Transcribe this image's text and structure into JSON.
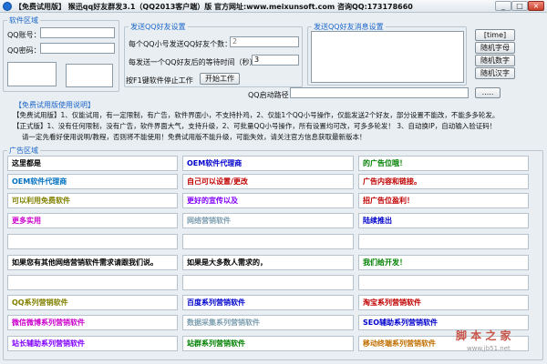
{
  "window": {
    "title": "【免费试用版】 猴迅qq好友群发3.1（QQ2013客户端）版  官方网址:www.meixunsoft.com 咨询QQ:173178660",
    "buttons": {
      "minimize": "_",
      "maximize": "□",
      "close": "×"
    }
  },
  "software_area": {
    "legend": "软件区域",
    "qq_label": "QQ账号：",
    "pwd_label": "QQ密码："
  },
  "friend_settings": {
    "legend": "发送QQ好友设置",
    "per_qq_label": "每个QQ小号发送QQ好友个数：",
    "per_qq_value": "2",
    "wait_label": "每发送一个QQ好友后的等待时间（秒）：",
    "wait_value": "3",
    "hint": "按F1键软件停止工作",
    "start_button": "开始工作"
  },
  "message_settings": {
    "legend": "发送QQ好友消息设置"
  },
  "side_buttons": [
    "[time]",
    "随机字母",
    "随机数字",
    "随机汉字"
  ],
  "qq_path": {
    "label": "QQ启动路径：",
    "value": "",
    "browse": "....."
  },
  "help": {
    "legend": "【免费试用版使用说明】",
    "lines": [
      "【免费试用版】1、仅能试用，有一定限制，有广告，软件界面小，不支持扑鸡，2、仅能1个QQ小号操作，仅能发送2个好友，部分设置不能改，不能多多轮发。",
      "【正式版】1、没有任何限制，没有广告，软件界面大气，支持升级，2、可批量QQ小号操作，所有设置均可改，可多多轮发！ 3、自动换IP，自动输入验证码！",
      "请一定先看好使用说明/教程，否则将不能使用！免费试用版不能升级，可能失效，请关注官方信息获取最新版本！"
    ]
  },
  "ads": {
    "legend": "广告区域",
    "cells": [
      {
        "text": "这里都是",
        "color": "#000000"
      },
      {
        "text": "OEM软件代理商",
        "color": "#0000cc"
      },
      {
        "text": "的广告位哦！",
        "color": "#008000"
      },
      {
        "text": "OEM软件代理商",
        "color": "#0070c0"
      },
      {
        "text": "自己可以设置/更改",
        "color": "#c00000"
      },
      {
        "text": "广告内容和链接。",
        "color": "#c00000"
      },
      {
        "text": "可以利用免费软件",
        "color": "#808000"
      },
      {
        "text": "更好的宣传以及",
        "color": "#8000ff"
      },
      {
        "text": "招广告位盈利！",
        "color": "#c00000"
      },
      {
        "text": "更多实用",
        "color": "#cc00cc"
      },
      {
        "text": "网络营销软件",
        "color": "#7f9fb0"
      },
      {
        "text": "陆续推出",
        "color": "#0000cc"
      },
      {
        "text": "",
        "color": "#000000"
      },
      {
        "text": "",
        "color": "#000000"
      },
      {
        "text": "",
        "color": "#000000"
      },
      {
        "text": "如果您有其他网络营销软件需求请跟我们说。",
        "color": "#000000"
      },
      {
        "text": "如果是大多数人需求的，",
        "color": "#000000"
      },
      {
        "text": "我们给开发！",
        "color": "#008000"
      },
      {
        "text": "",
        "color": "#000000"
      },
      {
        "text": "",
        "color": "#000000"
      },
      {
        "text": "",
        "color": "#000000"
      },
      {
        "text": "QQ系列营销软件",
        "color": "#808000"
      },
      {
        "text": "百度系列营销软件",
        "color": "#0000cc"
      },
      {
        "text": "淘宝系列营销软件",
        "color": "#c00000"
      },
      {
        "text": "微信微博系列营销软件",
        "color": "#cc00cc"
      },
      {
        "text": "数据采集系列营销软件",
        "color": "#7f9fb0"
      },
      {
        "text": "SEO辅助系列营销软件",
        "color": "#0000cc"
      },
      {
        "text": "站长辅助系列营销软件",
        "color": "#8000ff"
      },
      {
        "text": "站群系列营销软件",
        "color": "#008000"
      },
      {
        "text": "移动终端系列营销软件",
        "color": "#c07000"
      }
    ]
  },
  "watermark": {
    "main": "脚 本 之 家",
    "sub": "www.jb51.net"
  }
}
